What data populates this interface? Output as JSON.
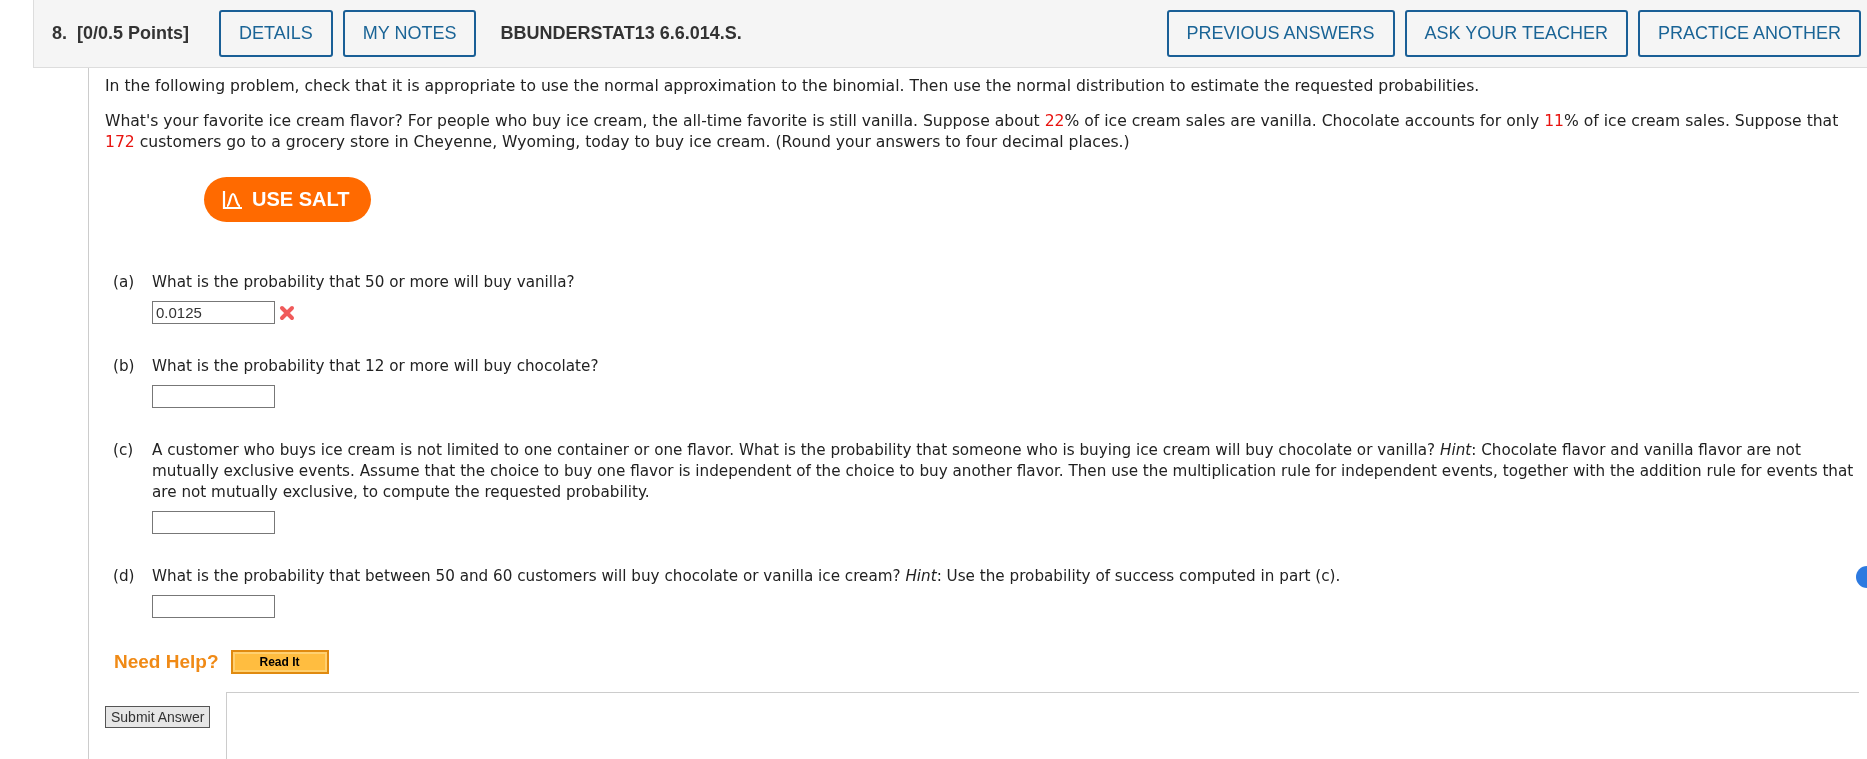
{
  "question": {
    "number": "8.",
    "points": "[0/0.5 Points]",
    "buttons": [
      "DETAILS",
      "MY NOTES"
    ],
    "code": "BBUNDERSTAT13 6.6.014.S.",
    "right_buttons": [
      "PREVIOUS ANSWERS",
      "ASK YOUR TEACHER",
      "PRACTICE ANOTHER"
    ]
  },
  "intro": [
    [
      {
        "kind": "plain",
        "text": "In the following problem, check that it is appropriate to use the normal approximation to the binomial. Then use the normal distribution to estimate the requested probabilities."
      }
    ],
    [
      {
        "kind": "plain",
        "text": "What's your favorite ice cream flavor? For people who buy ice cream, the all-time favorite is still vanilla. Suppose about "
      },
      {
        "kind": "red",
        "text": "22"
      },
      {
        "kind": "plain",
        "text": "% of ice cream sales are vanilla. Chocolate accounts for only "
      },
      {
        "kind": "red",
        "text": "11"
      },
      {
        "kind": "plain",
        "text": "% of ice cream sales. Suppose that "
      },
      {
        "kind": "red",
        "text": "172"
      },
      {
        "kind": "plain",
        "text": " customers go to a grocery store in Cheyenne, Wyoming, today to buy ice cream. (Round your answers to four decimal places.)"
      }
    ]
  ],
  "salt_button": "USE SALT",
  "parts": [
    {
      "label": "(a)",
      "text": [
        {
          "kind": "plain",
          "text": "What is the probability that 50 or more will buy vanilla?"
        }
      ],
      "value": "0.0125",
      "incorrect": true
    },
    {
      "label": "(b)",
      "text": [
        {
          "kind": "plain",
          "text": "What is the probability that 12 or more will buy chocolate?"
        }
      ],
      "incorrect": false
    },
    {
      "label": "(c)",
      "text": [
        {
          "kind": "plain",
          "text": "A customer who buys ice cream is not limited to one container or one flavor. What is the probability that someone who is buying ice cream will buy chocolate or vanilla? "
        },
        {
          "kind": "italic",
          "text": "Hint"
        },
        {
          "kind": "plain",
          "text": ": Chocolate flavor and vanilla flavor are not mutually exclusive events. Assume that the choice to buy one flavor is independent of the choice to buy another flavor. Then use the multiplication rule for independent events, together with the addition rule for events that are not mutually exclusive, to compute the requested probability."
        }
      ],
      "incorrect": false
    },
    {
      "label": "(d)",
      "text": [
        {
          "kind": "plain",
          "text": "What is the probability that between 50 and 60 customers will buy chocolate or vanilla ice cream? "
        },
        {
          "kind": "italic",
          "text": "Hint"
        },
        {
          "kind": "plain",
          "text": ": Use the probability of success computed in part (c)."
        }
      ],
      "incorrect": false
    }
  ],
  "help": {
    "label": "Need Help?",
    "button": "Read It"
  },
  "submit_button": "Submit Answer"
}
